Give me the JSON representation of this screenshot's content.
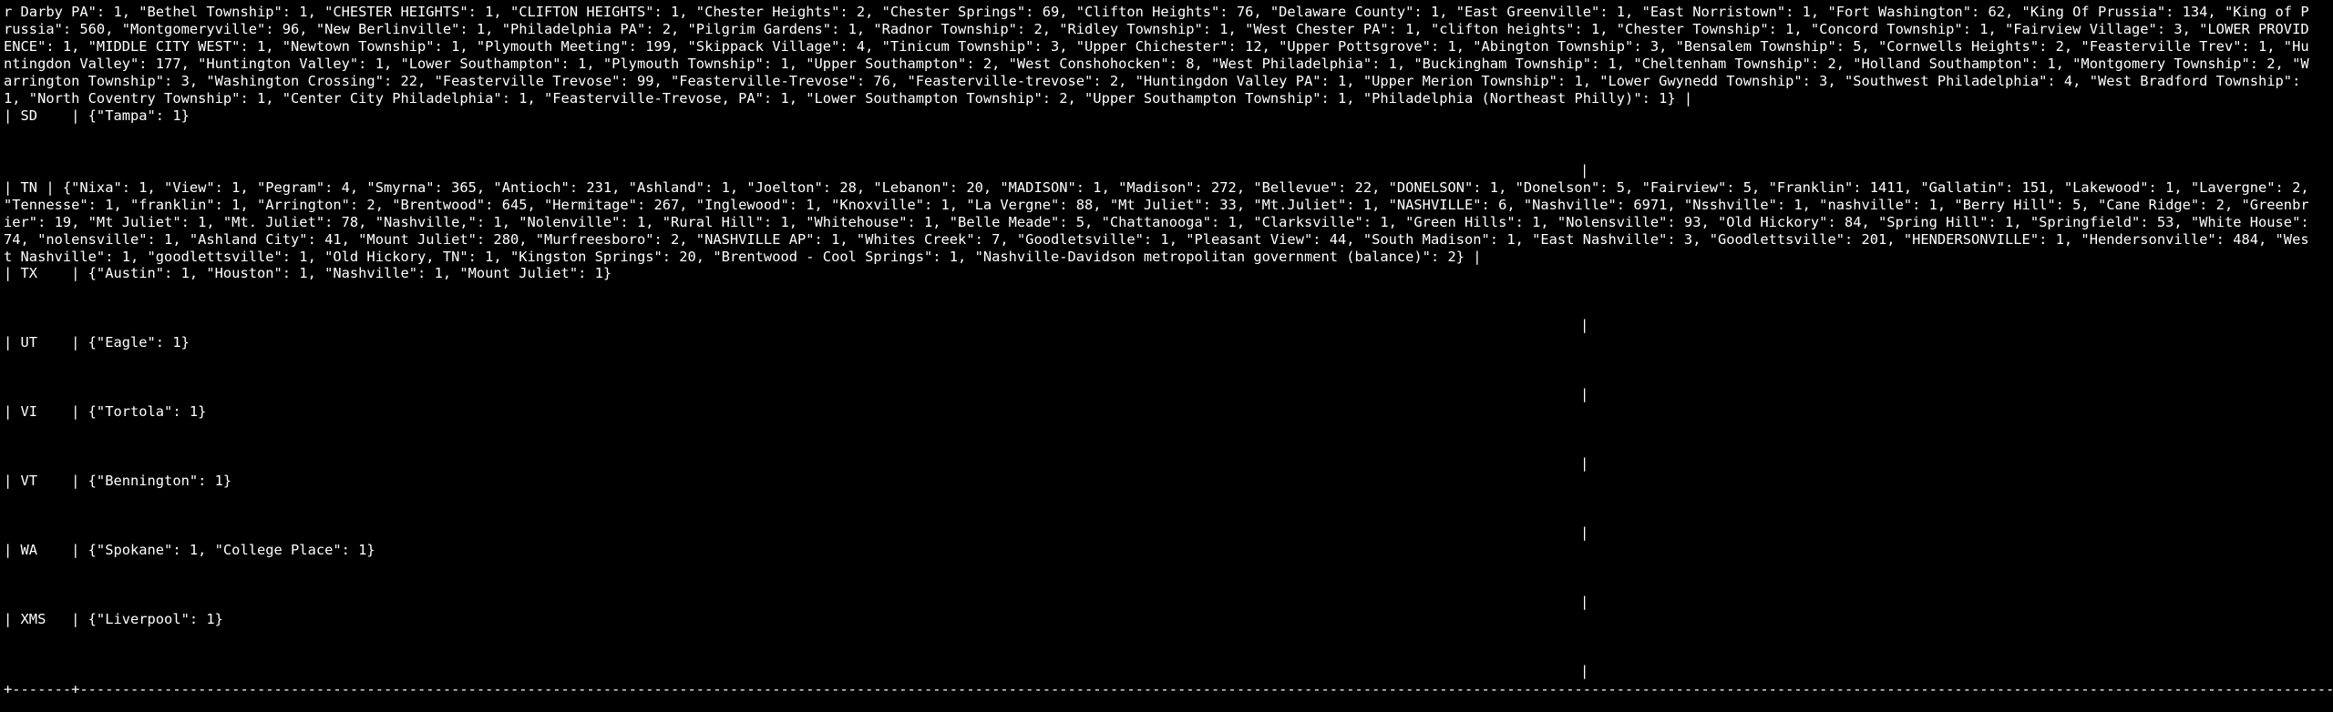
{
  "terminal": {
    "pa_continuation": "r Darby PA\": 1, \"Bethel Township\": 1, \"CHESTER HEIGHTS\": 1, \"CLIFTON HEIGHTS\": 1, \"Chester Heights\": 2, \"Chester Springs\": 69, \"Clifton Heights\": 76, \"Delaware County\": 1, \"East Greenville\": 1, \"East Norristown\": 1, \"Fort Washington\": 62, \"King Of Prussia\": 134, \"King of Prussia\": 560, \"Montgomeryville\": 96, \"New Berlinville\": 1, \"Philadelphia PA\": 2, \"Pilgrim Gardens\": 1, \"Radnor Township\": 2, \"Ridley Township\": 1, \"West Chester PA\": 1, \"clifton heights\": 1, \"Chester Township\": 1, \"Concord Township\": 1, \"Fairview Village\": 3, \"LOWER PROVIDENCE\": 1, \"MIDDLE CITY WEST\": 1, \"Newtown Township\": 1, \"Plymouth Meeting\": 199, \"Skippack Village\": 4, \"Tinicum Township\": 3, \"Upper Chichester\": 12, \"Upper Pottsgrove\": 1, \"Abington Township\": 3, \"Bensalem Township\": 5, \"Cornwells Heights\": 2, \"Feasterville Trev\": 1, \"Huntingdon Valley\": 177, \"Huntington Valley\": 1, \"Lower Southampton\": 1, \"Plymouth Township\": 1, \"Upper Southampton\": 2, \"West Conshohocken\": 8, \"West Philadelphia\": 1, \"Buckingham Township\": 1, \"Cheltenham Township\": 2, \"Holland Southampton\": 1, \"Montgomery Township\": 2, \"Warrington Township\": 3, \"Washington Crossing\": 22, \"Feasterville Trevose\": 99, \"Feasterville-Trevose\": 76, \"Feasterville-trevose\": 2, \"Huntingdon Valley PA\": 1, \"Upper Merion Township\": 1, \"Lower Gwynedd Township\": 3, \"Southwest Philadelphia\": 4, \"West Bradford Township\": 1, \"North Coventry Township\": 1, \"Center City Philadelphia\": 1, \"Feasterville-Trevose, PA\": 1, \"Lower Southampton Township\": 2, \"Upper Southampton Township\": 1, \"Philadelphia (Northeast Philly)\": 1} |",
    "row_sd": "| SD    | {\"Tampa\": 1}",
    "row_tn": "| TN    | {\"Nixa\": 1, \"View\": 1, \"Pegram\": 4, \"Smyrna\": 365, \"Antioch\": 231, \"Ashland\": 1, \"Joelton\": 28, \"Lebanon\": 20, \"MADISON\": 1, \"Madison\": 272, \"Bellevue\": 22, \"DONELSON\": 1, \"Donelson\": 5, \"Fairview\": 5, \"Franklin\": 1411, \"Gallatin\": 151, \"Lakewood\": 1, \"Lavergne\": 2, \"Tennesse\": 1, \"franklin\": 1, \"Arrington\": 2, \"Brentwood\": 645, \"Hermitage\": 267, \"Inglewood\": 1, \"Knoxville\": 1, \"La Vergne\": 88, \"Mt Juliet\": 33, \"Mt.Juliet\": 1, \"NASHVILLE\": 6, \"Nashville\": 6971, \"Nsshville\": 1, \"nashville\": 1, \"Berry Hill\": 5, \"Cane Ridge\": 2, \"Greenbrier\": 19, \"Mt  Juliet\": 1, \"Mt. Juliet\": 78, \"Nashville,\": 1, \"Nolenville\": 1, \"Rural Hill\": 1, \"Whitehouse\": 1, \"Belle Meade\": 5, \"Chattanooga\": 1, \"Clarksville\": 1, \"Green Hills\": 1, \"Nolensville\": 93, \"Old Hickory\": 84, \"Spring Hill\": 1, \"Springfield\": 53, \"White House\": 74, \"nolensville\": 1, \"Ashland City\": 41, \"Mount Juliet\": 280, \"Murfreesboro\": 2, \"NASHVILLE AP\": 1, \"Whites Creek\": 7, \"Goodletsville\": 1, \"Pleasant View\": 44, \"South Madison\": 1, \"East Nashville\": 3, \"Goodlettsville\": 201, \"HENDERSONVILLE\": 1, \"Hendersonville\": 484, \"West Nashville\": 1, \"goodlettsville\": 1, \"Old Hickory, TN\": 1, \"Kingston Springs\": 20, \"Brentwood - Cool Springs\": 1, \"Nashville-Davidson metropolitan government (balance)\": 2} |",
    "row_tx": "| TX    | {\"Austin\": 1, \"Houston\": 1, \"Nashville\": 1, \"Mount Juliet\": 1}",
    "row_ut": "| UT    | {\"Eagle\": 1}",
    "row_vi": "| VI    | {\"Tortola\": 1}",
    "row_vt": "| VT    | {\"Bennington\": 1}",
    "row_wa": "| WA    | {\"Spokane\": 1, \"College Place\": 1}",
    "row_xms": "| XMS   | {\"Liverpool\": 1}",
    "pipe": "|",
    "bottom_border": "+-------+---------------------------------------------------------------------------------------------------------------------------------------------------------------------------------------------------------------------------------------------------------------------------------------------------"
  }
}
